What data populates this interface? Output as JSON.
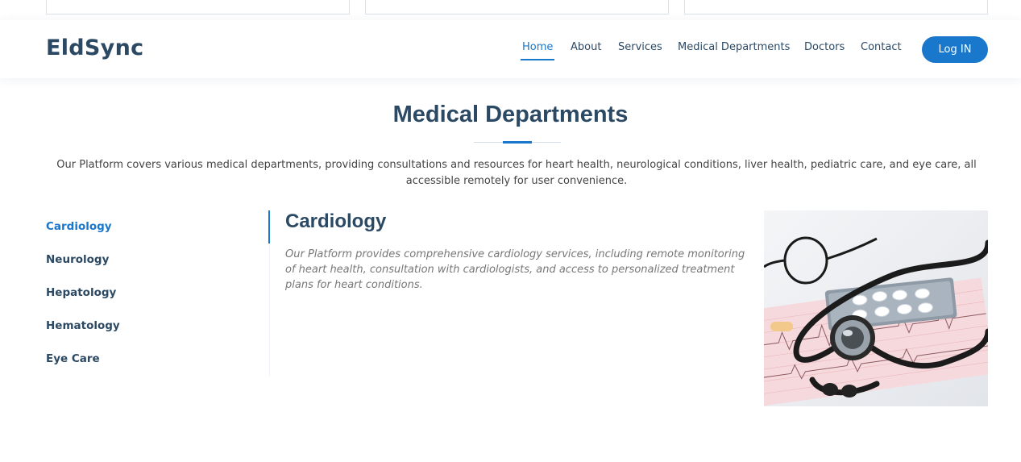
{
  "header": {
    "logo": "EldSync",
    "nav": [
      {
        "label": "Home",
        "active": true
      },
      {
        "label": "About"
      },
      {
        "label": "Services"
      },
      {
        "label": "Medical Departments"
      },
      {
        "label": "Doctors"
      },
      {
        "label": "Contact"
      }
    ],
    "login_label": "Log IN"
  },
  "section": {
    "title": "Medical Departments",
    "description": "Our Platform covers various medical departments, providing consultations and resources for heart health, neurological conditions, liver health, pediatric care, and eye care, all accessible remotely for user convenience."
  },
  "tabs": [
    {
      "label": "Cardiology",
      "active": true
    },
    {
      "label": "Neurology"
    },
    {
      "label": "Hepatology"
    },
    {
      "label": "Hematology"
    },
    {
      "label": "Eye Care"
    }
  ],
  "content": {
    "title": "Cardiology",
    "text": "Our Platform provides comprehensive cardiology services, including remote monitoring of heart health, consultation with cardiologists, and access to personalized treatment plans for heart conditions.",
    "image_icon": "stethoscope-image"
  },
  "colors": {
    "accent": "#1977cc",
    "heading": "#2c4964",
    "body_text": "#444444",
    "muted_text": "#777777"
  }
}
